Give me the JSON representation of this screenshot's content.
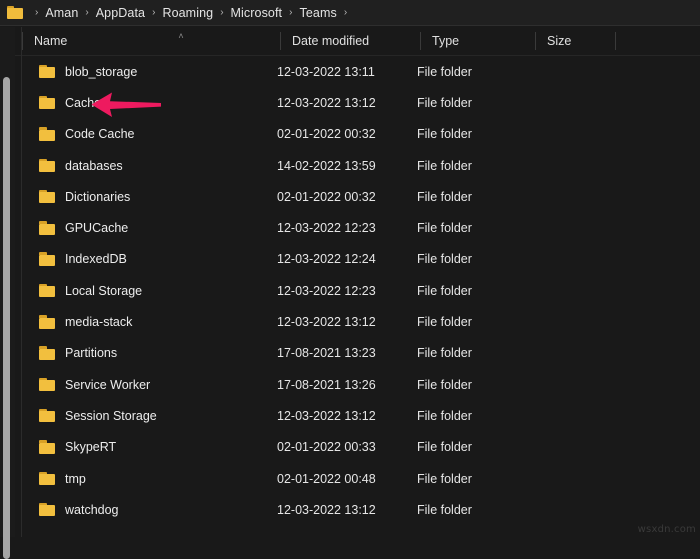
{
  "window": {
    "theme_background": "#191919",
    "accent_folder_color": "#f2bf3e"
  },
  "addressbar": {
    "folder_icon": "folder-icon",
    "separator": "›",
    "crumbs": [
      {
        "label": "Aman"
      },
      {
        "label": "AppData"
      },
      {
        "label": "Roaming"
      },
      {
        "label": "Microsoft"
      },
      {
        "label": "Teams"
      }
    ]
  },
  "columns": {
    "name": {
      "label": "Name",
      "sort_caret": "˄",
      "sort_direction": "ascending"
    },
    "date_modified": {
      "label": "Date modified"
    },
    "type": {
      "label": "Type"
    },
    "size": {
      "label": "Size"
    }
  },
  "annotation": {
    "arrow_color": "#ee1a5f",
    "points_at": "Cache"
  },
  "rows": [
    {
      "name": "blob_storage",
      "date": "12-03-2022 13:11",
      "type": "File folder",
      "size": ""
    },
    {
      "name": "Cache",
      "date": "12-03-2022 13:12",
      "type": "File folder",
      "size": ""
    },
    {
      "name": "Code Cache",
      "date": "02-01-2022 00:32",
      "type": "File folder",
      "size": ""
    },
    {
      "name": "databases",
      "date": "14-02-2022 13:59",
      "type": "File folder",
      "size": ""
    },
    {
      "name": "Dictionaries",
      "date": "02-01-2022 00:32",
      "type": "File folder",
      "size": ""
    },
    {
      "name": "GPUCache",
      "date": "12-03-2022 12:23",
      "type": "File folder",
      "size": ""
    },
    {
      "name": "IndexedDB",
      "date": "12-03-2022 12:24",
      "type": "File folder",
      "size": ""
    },
    {
      "name": "Local Storage",
      "date": "12-03-2022 12:23",
      "type": "File folder",
      "size": ""
    },
    {
      "name": "media-stack",
      "date": "12-03-2022 13:12",
      "type": "File folder",
      "size": ""
    },
    {
      "name": "Partitions",
      "date": "17-08-2021 13:23",
      "type": "File folder",
      "size": ""
    },
    {
      "name": "Service Worker",
      "date": "17-08-2021 13:26",
      "type": "File folder",
      "size": ""
    },
    {
      "name": "Session Storage",
      "date": "12-03-2022 13:12",
      "type": "File folder",
      "size": ""
    },
    {
      "name": "SkypeRT",
      "date": "02-01-2022 00:33",
      "type": "File folder",
      "size": ""
    },
    {
      "name": "tmp",
      "date": "02-01-2022 00:48",
      "type": "File folder",
      "size": ""
    },
    {
      "name": "watchdog",
      "date": "12-03-2022 13:12",
      "type": "File folder",
      "size": ""
    }
  ],
  "watermark": {
    "text": "wsxdn.com"
  }
}
